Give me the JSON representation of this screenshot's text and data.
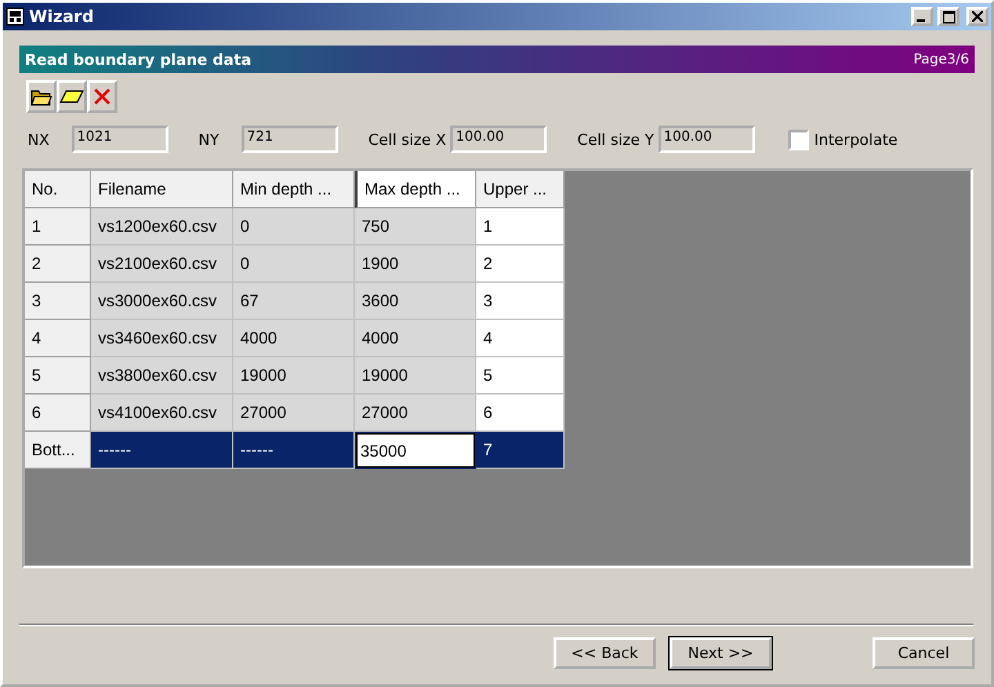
{
  "window": {
    "title": "Wizard"
  },
  "banner": {
    "title": "Read boundary plane data",
    "page": "Page3/6"
  },
  "fields": [
    {
      "label": "NX",
      "value": "1021"
    },
    {
      "label": "NY",
      "value": "721"
    },
    {
      "label": "Cell size X",
      "value": "100.00"
    },
    {
      "label": "Cell size Y",
      "value": "100.00"
    }
  ],
  "interpolate": {
    "label": "Interpolate",
    "checked": false
  },
  "table": {
    "columns": [
      {
        "label": "No.",
        "kind": "header",
        "current": false
      },
      {
        "label": "Filename",
        "kind": "readonly",
        "current": false
      },
      {
        "label": "Min depth ...",
        "kind": "readonly",
        "current": false
      },
      {
        "label": "Max depth ...",
        "kind": "readonly",
        "current": true
      },
      {
        "label": "Upper ...",
        "kind": "editable",
        "current": false
      }
    ],
    "rows": [
      {
        "cells": [
          "1",
          "vs1200ex60.csv",
          "0",
          "750",
          "1"
        ],
        "selected": false,
        "editing": false
      },
      {
        "cells": [
          "2",
          "vs2100ex60.csv",
          "0",
          "1900",
          "2"
        ],
        "selected": false,
        "editing": false
      },
      {
        "cells": [
          "3",
          "vs3000ex60.csv",
          "67",
          "3600",
          "3"
        ],
        "selected": false,
        "editing": false
      },
      {
        "cells": [
          "4",
          "vs3460ex60.csv",
          "4000",
          "4000",
          "4"
        ],
        "selected": false,
        "editing": false
      },
      {
        "cells": [
          "5",
          "vs3800ex60.csv",
          "19000",
          "19000",
          "5"
        ],
        "selected": false,
        "editing": false
      },
      {
        "cells": [
          "6",
          "vs4100ex60.csv",
          "27000",
          "27000",
          "6"
        ],
        "selected": false,
        "editing": false
      },
      {
        "cells": [
          "Bott...",
          "------",
          "------",
          "35000",
          "7"
        ],
        "selected": true,
        "editing": true
      }
    ]
  },
  "buttons": [
    {
      "label": "<< Back",
      "default": false
    },
    {
      "label": "Next >>",
      "default": true
    },
    {
      "label": "Cancel",
      "default": false
    }
  ]
}
